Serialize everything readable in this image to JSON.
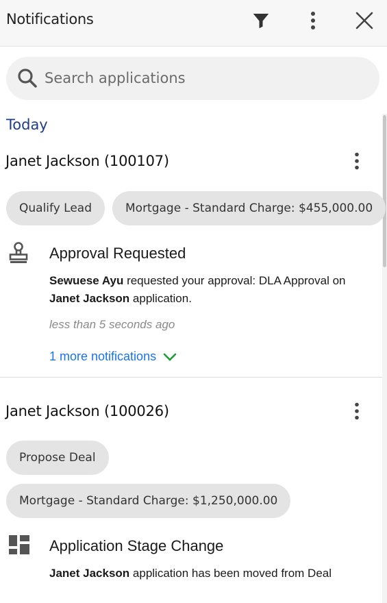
{
  "header": {
    "title": "Notifications",
    "filter_icon": "filter-icon",
    "more_icon": "more-vertical-icon",
    "close_icon": "close-icon"
  },
  "search": {
    "placeholder": "Search applications",
    "value": ""
  },
  "section": {
    "label": "Today"
  },
  "colors": {
    "section_label": "#1f3c88",
    "link": "#1a73e8",
    "chevron": "#1e9e3a",
    "chip_bg": "#e4e4e4"
  },
  "cards": [
    {
      "name": "Janet Jackson (100107)",
      "chips": [
        "Qualify Lead",
        "Mortgage - Standard Charge: $455,000.00"
      ],
      "notification": {
        "icon": "stamp-icon",
        "title": "Approval Requested",
        "actor": "Sewuese Ayu",
        "text_1": " requested your approval: DLA Approval on ",
        "subject": "Janet Jackson",
        "text_2": " application.",
        "time": "less than 5 seconds ago",
        "more": "1 more notifications"
      }
    },
    {
      "name": "Janet Jackson (100026)",
      "chips": [
        "Propose Deal",
        "Mortgage - Standard Charge: $1,250,000.00"
      ],
      "notification": {
        "icon": "dashboard-icon",
        "title": "Application Stage Change",
        "subject": "Janet Jackson",
        "text_1": " application has been moved from Deal"
      }
    }
  ]
}
